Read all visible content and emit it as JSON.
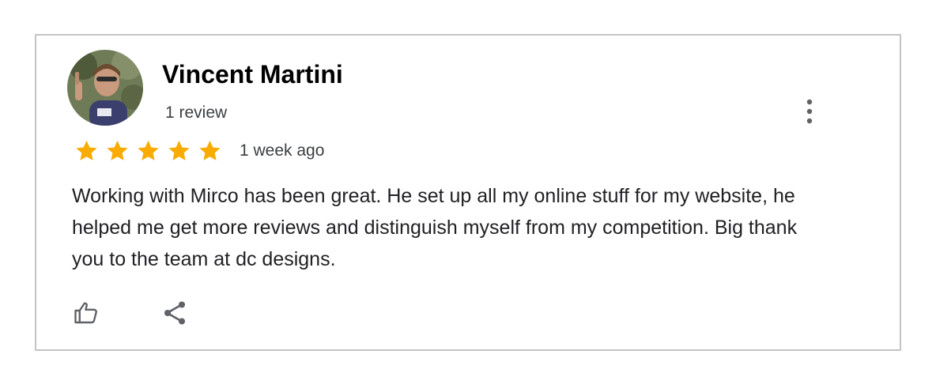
{
  "review": {
    "author_name": "Vincent Martini",
    "author_review_count": "1 review",
    "rating": 5,
    "rating_max": 5,
    "date": "1 week ago",
    "text": "Working with Mirco has been great. He set up all my online stuff for my website, he helped me get more reviews and distinguish myself from my competition. Big thank you to the team at dc designs."
  },
  "icons": {
    "avatar": "profile-photo",
    "more": "more-vertical-icon",
    "star": "star-icon",
    "like": "thumbs-up-icon",
    "share": "share-icon"
  },
  "colors": {
    "star": "#f9ab00",
    "icon": "#5f6368",
    "border": "#c4c4c4"
  }
}
